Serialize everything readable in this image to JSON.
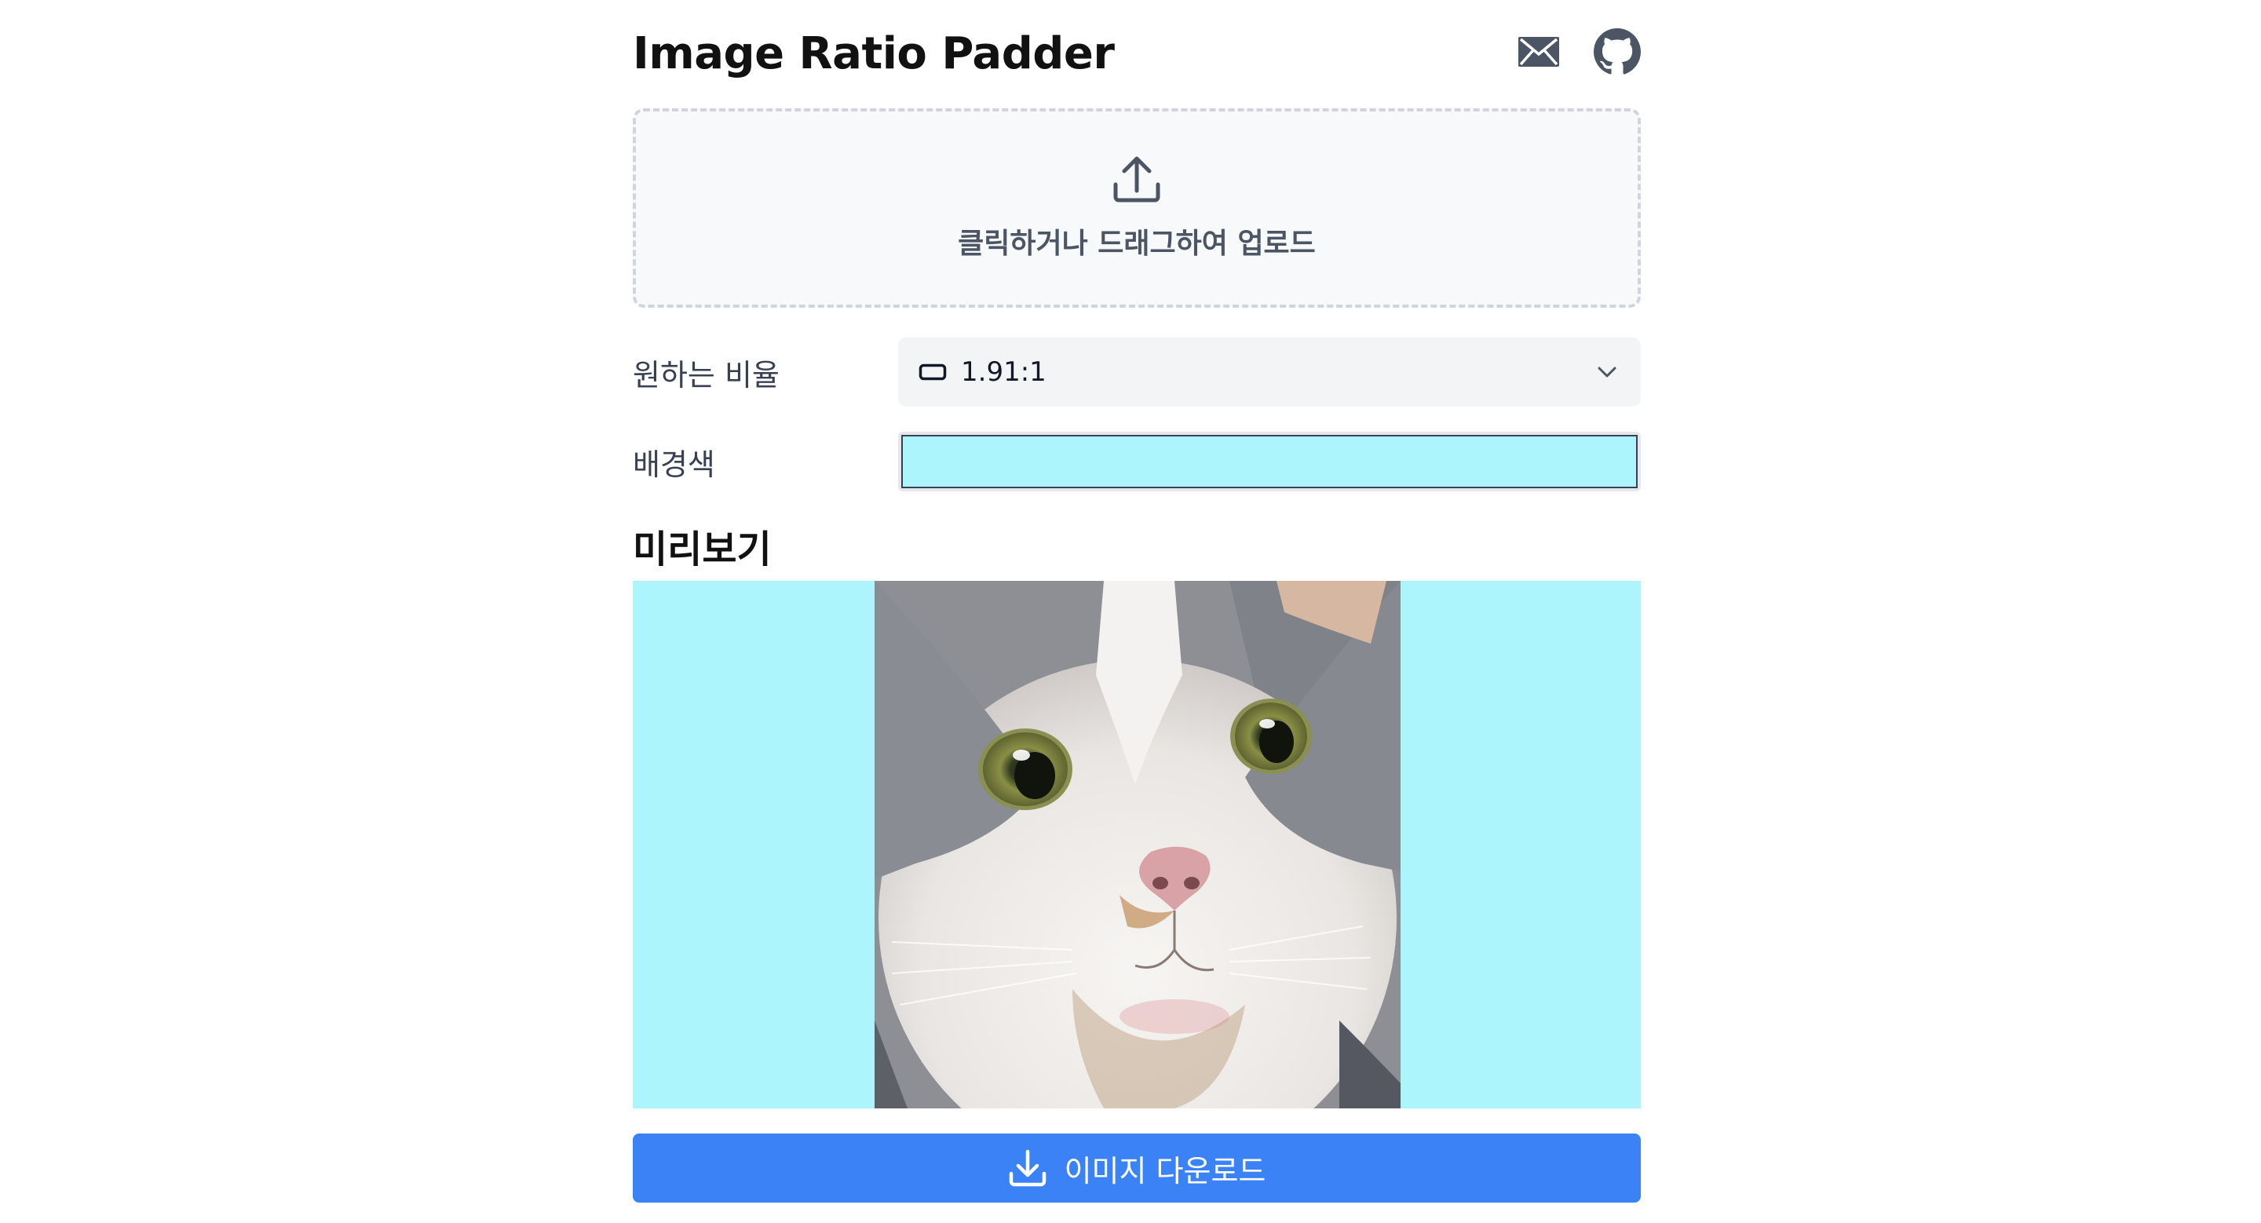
{
  "app": {
    "title": "Image Ratio Padder"
  },
  "header": {
    "icons": [
      "mail-icon",
      "github-icon"
    ]
  },
  "upload": {
    "icon": "upload-icon",
    "label": "클릭하거나 드래그하여 업로드"
  },
  "ratio": {
    "label": "원하는 비율",
    "icon": "rectangle-icon",
    "value": "1.91:1",
    "chevron": "chevron-down-icon"
  },
  "background": {
    "label": "배경색",
    "color": "#adf5fc"
  },
  "preview": {
    "title": "미리보기",
    "pad_color": "#adf5fc"
  },
  "download": {
    "icon": "download-icon",
    "label": "이미지 다운로드"
  },
  "colors": {
    "accent": "#3b82f6",
    "upload_bg": "#f8f9fb",
    "upload_border": "#d1d5db",
    "select_bg": "#f3f4f6"
  }
}
